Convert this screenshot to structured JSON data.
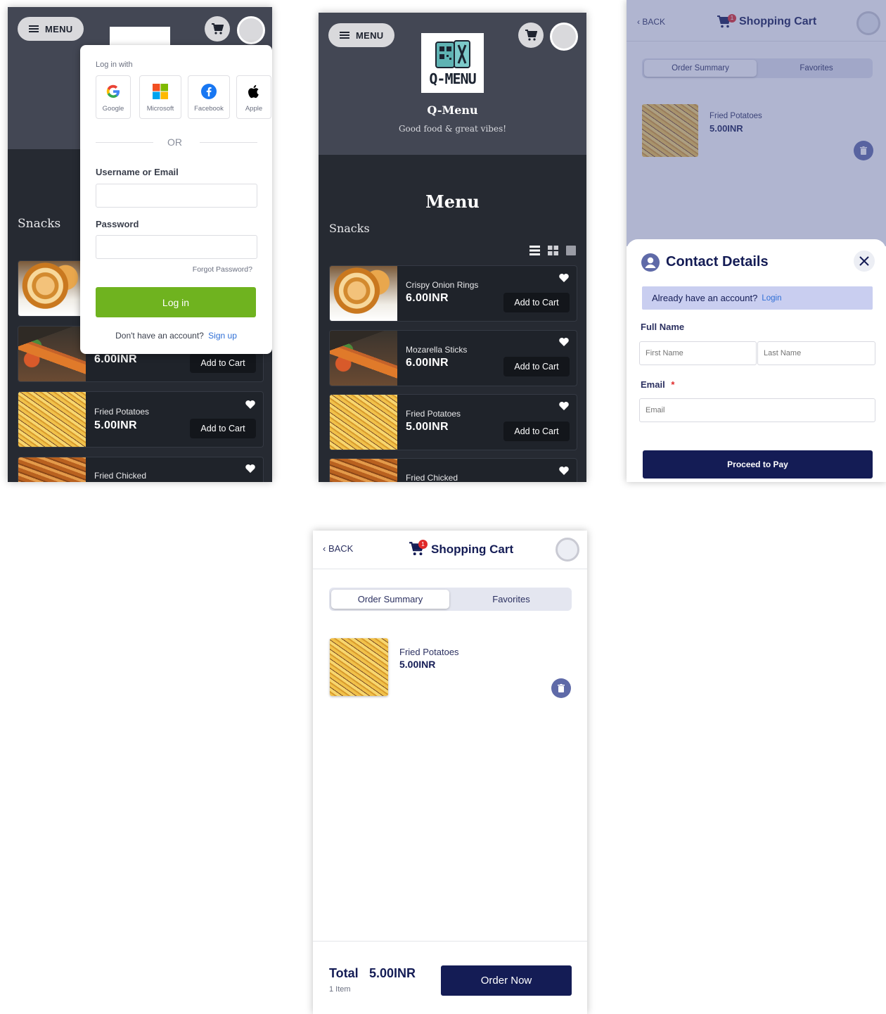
{
  "brand": {
    "menu_label": "MENU",
    "logo_text": "Q-MENU",
    "name": "Q-Menu",
    "tagline": "Good food & great vibes!",
    "section_title": "Menu",
    "category": "Snacks"
  },
  "items": [
    {
      "name": "Crispy Onion Rings",
      "price": "6.00INR",
      "action": "Add to Cart"
    },
    {
      "name": "Mozarella Sticks",
      "price": "6.00INR",
      "action": "Add to Cart"
    },
    {
      "name": "Fried Potatoes",
      "price": "5.00INR",
      "action": "Add to Cart"
    },
    {
      "name": "Fried Chicked",
      "price": "",
      "action": ""
    }
  ],
  "login": {
    "heading": "Log in with",
    "providers": [
      "Google",
      "Microsoft",
      "Facebook",
      "Apple"
    ],
    "or": "OR",
    "username_label": "Username or Email",
    "password_label": "Password",
    "forgot": "Forgot Password?",
    "submit": "Log in",
    "no_account": "Don't have an account?",
    "signup": "Sign up"
  },
  "cart": {
    "back": "BACK",
    "title": "Shopping Cart",
    "badge": "1",
    "tab_order": "Order Summary",
    "tab_fav": "Favorites",
    "item_name": "Fried Potatoes",
    "item_price": "5.00INR",
    "total_label": "Total",
    "total_value": "5.00INR",
    "item_count": "1 Item",
    "order_now": "Order Now"
  },
  "contact": {
    "title": "Contact Details",
    "already": "Already have an account?",
    "login_link": "Login",
    "full_name": "Full Name",
    "first_ph": "First Name",
    "last_ph": "Last Name",
    "email_label": "Email",
    "required": "*",
    "email_ph": "Email",
    "proceed": "Proceed to Pay"
  },
  "colors": {
    "accent_green": "#6fb31f",
    "navy": "#141c55",
    "link_blue": "#2f6fd6",
    "dark_bg": "#262a32"
  }
}
